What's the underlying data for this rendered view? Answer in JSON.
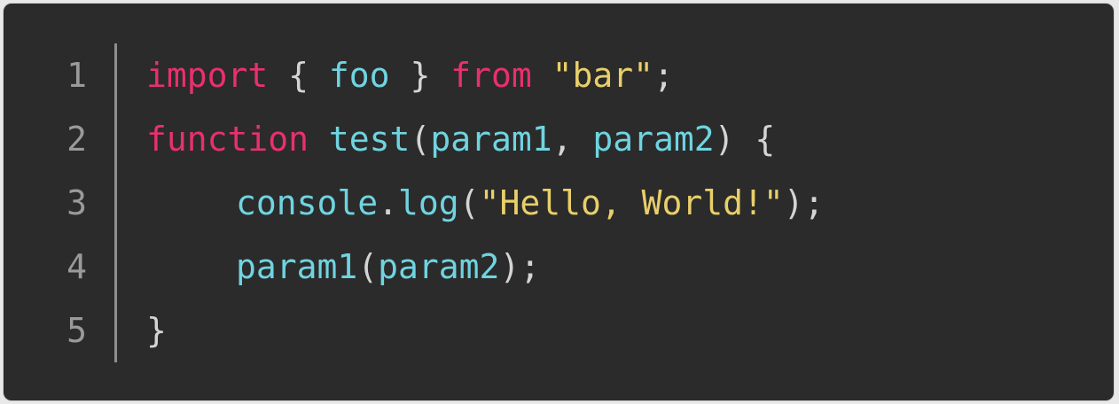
{
  "editor": {
    "line_numbers": [
      "1",
      "2",
      "3",
      "4",
      "5"
    ],
    "lines": [
      [
        {
          "t": "import",
          "k": "kw"
        },
        {
          "t": " { ",
          "k": "pn"
        },
        {
          "t": "foo",
          "k": "id"
        },
        {
          "t": " } ",
          "k": "pn"
        },
        {
          "t": "from",
          "k": "kw"
        },
        {
          "t": " ",
          "k": "pn"
        },
        {
          "t": "\"bar\"",
          "k": "str"
        },
        {
          "t": ";",
          "k": "pn"
        }
      ],
      [
        {
          "t": "function",
          "k": "kw"
        },
        {
          "t": " ",
          "k": "pn"
        },
        {
          "t": "test",
          "k": "id"
        },
        {
          "t": "(",
          "k": "pn"
        },
        {
          "t": "param1",
          "k": "id"
        },
        {
          "t": ", ",
          "k": "pn"
        },
        {
          "t": "param2",
          "k": "id"
        },
        {
          "t": ") {",
          "k": "pn"
        }
      ],
      [
        {
          "t": "console",
          "k": "id"
        },
        {
          "t": ".",
          "k": "pn"
        },
        {
          "t": "log",
          "k": "id"
        },
        {
          "t": "(",
          "k": "pn"
        },
        {
          "t": "\"Hello, World!\"",
          "k": "str"
        },
        {
          "t": ");",
          "k": "pn"
        }
      ],
      [
        {
          "t": "param1",
          "k": "id"
        },
        {
          "t": "(",
          "k": "pn"
        },
        {
          "t": "param2",
          "k": "id"
        },
        {
          "t": ");",
          "k": "pn"
        }
      ],
      [
        {
          "t": "}",
          "k": "pn"
        }
      ]
    ],
    "colors": {
      "background": "#2b2b2b",
      "keyword": "#e8306f",
      "identifier": "#6fd4e0",
      "string": "#e8cf69",
      "punctuation": "#d4d4d4",
      "line_number": "#9a9a9a"
    }
  }
}
